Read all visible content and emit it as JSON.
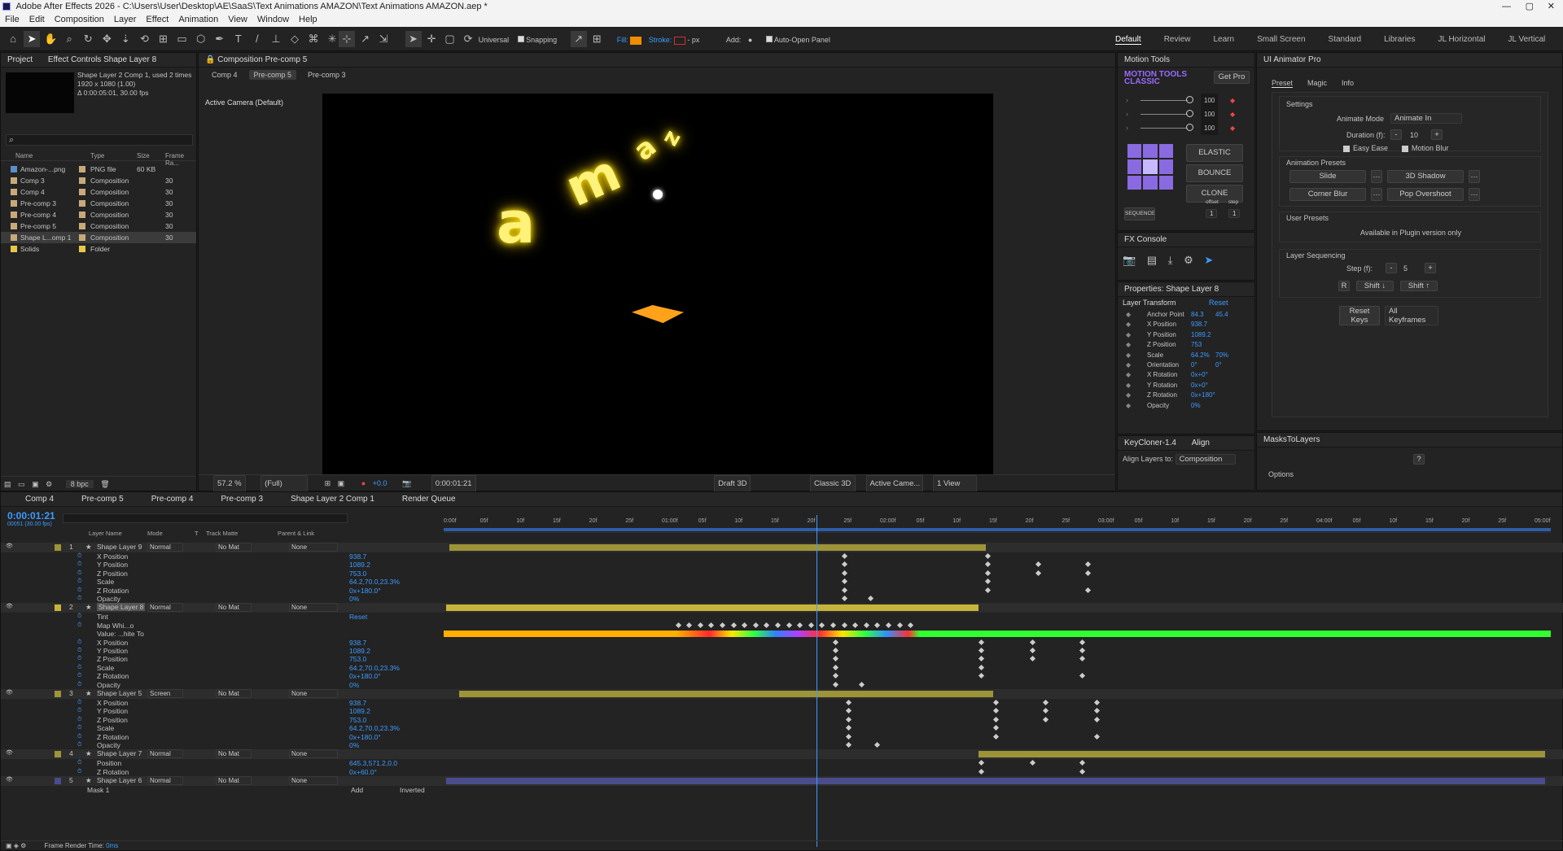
{
  "app": {
    "title": "Adobe After Effects 2026 - C:\\Users\\User\\Desktop\\AE\\SaaS\\Text Animations AMAZON\\Text Animations AMAZON.aep *",
    "menu": [
      "File",
      "Edit",
      "Composition",
      "Layer",
      "Effect",
      "Animation",
      "View",
      "Window",
      "Help"
    ]
  },
  "toolbar": {
    "universal": "Universal",
    "snapping": "Snapping",
    "fill_label": "Fill:",
    "stroke_label": "Stroke:",
    "stroke_unit": "- px",
    "add_label": "Add:",
    "auto_open": "Auto-Open Panel",
    "fill_color": "#f08c00",
    "workspaces": [
      "Default",
      "Review",
      "Learn",
      "Small Screen",
      "Standard",
      "Libraries",
      "JL Horizontal",
      "JL Vertical"
    ]
  },
  "project": {
    "tab": "Project",
    "tab2": "Effect Controls Shape Layer 8",
    "selected_name": "Shape Layer 2 Comp 1",
    "selected_usage": ", used 2 times",
    "selected_dims": "1920 x 1080 (1.00)",
    "selected_duration": "Δ 0:00:05:01, 30.00 fps",
    "columns": [
      "Name",
      "Type",
      "Size",
      "Frame Ra..."
    ],
    "items": [
      {
        "name": "Amazon-...png",
        "type": "PNG file",
        "size": "60 KB",
        "fps": "",
        "color": "#5c8ccc"
      },
      {
        "name": "Comp 3",
        "type": "Composition",
        "size": "",
        "fps": "30",
        "color": "#c8aa78"
      },
      {
        "name": "Comp 4",
        "type": "Composition",
        "size": "",
        "fps": "30",
        "color": "#c8aa78"
      },
      {
        "name": "Pre-comp 3",
        "type": "Composition",
        "size": "",
        "fps": "30",
        "color": "#c8aa78"
      },
      {
        "name": "Pre-comp 4",
        "type": "Composition",
        "size": "",
        "fps": "30",
        "color": "#c8aa78"
      },
      {
        "name": "Pre-comp 5",
        "type": "Composition",
        "size": "",
        "fps": "30",
        "color": "#c8aa78"
      },
      {
        "name": "Shape L...omp 1",
        "type": "Composition",
        "size": "",
        "fps": "30",
        "color": "#c8aa78"
      },
      {
        "name": "Solids",
        "type": "Folder",
        "size": "",
        "fps": "",
        "color": "#e8c84a"
      }
    ],
    "bpc": "8 bpc"
  },
  "composition": {
    "tab": "Composition Pre-comp 5",
    "breadcrumbs": [
      "Comp 4",
      "Pre-comp 5",
      "Pre-comp 3"
    ],
    "camera": "Active Camera (Default)",
    "zoom": "57.2 %",
    "resolution": "(Full)",
    "exposure": "+0.0",
    "time": "0:00:01:21",
    "renderer": "Draft 3D",
    "renderer2": "Classic 3D",
    "view_camera": "Active Came...",
    "views": "1 View",
    "letters": [
      "a",
      "m",
      "a",
      "z"
    ]
  },
  "motion_tools": {
    "title": "Motion Tools",
    "brand_line1": "MOTION TOOLS",
    "brand_line2": "CLASSIC",
    "get_pro": "Get Pro",
    "sliders": [
      "100",
      "100",
      "100"
    ],
    "buttons": [
      "ELASTIC",
      "BOUNCE",
      "CLONE"
    ],
    "sequence": "SEQUENCE",
    "offset_label": "offset",
    "step_label": "step",
    "offset": "1",
    "step": "1"
  },
  "fx_console": {
    "title": "FX Console"
  },
  "properties": {
    "title": "Properties: Shape Layer 8",
    "section": "Layer Transform",
    "reset": "Reset",
    "rows": [
      {
        "label": "Anchor Point",
        "v1": "84.3",
        "v2": "45.4"
      },
      {
        "label": "X Position",
        "v1": "938.7",
        "v2": ""
      },
      {
        "label": "Y Position",
        "v1": "1089.2",
        "v2": ""
      },
      {
        "label": "Z Position",
        "v1": "753",
        "v2": ""
      },
      {
        "label": "Scale",
        "v1": "64.2%",
        "v2": "70%"
      },
      {
        "label": "Orientation",
        "v1": "0°",
        "v2": "0°"
      },
      {
        "label": "X Rotation",
        "v1": "0x+0°",
        "v2": ""
      },
      {
        "label": "Y Rotation",
        "v1": "0x+0°",
        "v2": ""
      },
      {
        "label": "Z Rotation",
        "v1": "0x+180°",
        "v2": ""
      },
      {
        "label": "Opacity",
        "v1": "0%",
        "v2": ""
      }
    ]
  },
  "align": {
    "tab1": "KeyCloner-1.4",
    "tab2": "Align",
    "align_to_label": "Align Layers to:",
    "align_to": "Composition"
  },
  "ui_animator": {
    "title": "UI Animator Pro",
    "tabs": [
      "Preset",
      "Magic",
      "Info"
    ],
    "settings": "Settings",
    "animate_mode_label": "Animate Mode",
    "animate_mode": "Animate In",
    "duration_label": "Duration (f):",
    "duration": "10",
    "easy_ease": "Easy Ease",
    "motion_blur": "Motion Blur",
    "presets_title": "Animation Presets",
    "presets": [
      "Slide",
      "3D Shadow",
      "Corner Blur",
      "Pop Overshoot"
    ],
    "user_presets": "User Presets",
    "plugin_note": "Available in Plugin version only",
    "seq_title": "Layer Sequencing",
    "step_label": "Step (f):",
    "step": "5",
    "r": "R",
    "shift_down": "Shift ↓",
    "shift_up": "Shift ↑",
    "reset_keys": "Reset Keys",
    "all_keyframes": "All Keyframes"
  },
  "masks": {
    "title": "MasksToLayers",
    "options": "Options",
    "help": "?"
  },
  "timeline": {
    "tabs": [
      "Comp 4",
      "Pre-comp 5",
      "Pre-comp 4",
      "Pre-comp 3",
      "Shape Layer 2 Comp 1",
      "Render Queue"
    ],
    "time": "0:00:01:21",
    "time_sub": "00051 (30.00 fps)",
    "columns": [
      "Layer Name",
      "Mode",
      "T",
      "Track Matte",
      "Parent & Link"
    ],
    "ruler": [
      "0:00f",
      "05f",
      "10f",
      "15f",
      "20f",
      "25f",
      "01:00f",
      "05f",
      "10f",
      "15f",
      "20f",
      "25f",
      "02:00f",
      "05f",
      "10f",
      "15f",
      "20f",
      "25f",
      "03:00f",
      "05f",
      "10f",
      "15f",
      "20f",
      "25f",
      "04:00f",
      "05f",
      "10f",
      "15f",
      "20f",
      "25f",
      "05:00f"
    ],
    "rows": [
      {
        "kind": "layer",
        "num": "1",
        "name": "Shape Layer 9",
        "mode": "Normal",
        "matte": "No Mat",
        "parent": "None",
        "bar": [
          0.005,
          0.49
        ],
        "color": "#9d9438"
      },
      {
        "kind": "prop",
        "name": "X Position",
        "value": "938.7",
        "keys": [
          0.36,
          0.49
        ]
      },
      {
        "kind": "prop",
        "name": "Y Position",
        "value": "1089.2",
        "keys": [
          0.36,
          0.49,
          0.535,
          0.58
        ]
      },
      {
        "kind": "prop",
        "name": "Z Position",
        "value": "753.0",
        "keys": [
          0.36,
          0.49,
          0.535,
          0.58
        ]
      },
      {
        "kind": "prop",
        "name": "Scale",
        "value": "64.2,70.0,23.3%",
        "keys": [
          0.36,
          0.49
        ]
      },
      {
        "kind": "prop",
        "name": "Z Rotation",
        "value": "0x+180.0°",
        "keys": [
          0.36,
          0.49,
          0.58
        ]
      },
      {
        "kind": "prop",
        "name": "Opacity",
        "value": "0%",
        "keys": [
          0.36,
          0.384
        ]
      },
      {
        "kind": "layer",
        "num": "2",
        "name": "Shape Layer 8",
        "mode": "Normal",
        "matte": "No Mat",
        "parent": "None",
        "bar": [
          0.002,
          0.483
        ],
        "color": "#c8b43a"
      },
      {
        "kind": "effect",
        "name": "Tint",
        "value": "Reset",
        "keys": []
      },
      {
        "kind": "prop",
        "name": "Map Whi...o",
        "value": "",
        "keys": [
          0.21,
          0.22,
          0.23,
          0.24,
          0.25,
          0.26,
          0.27,
          0.28,
          0.29,
          0.3,
          0.31,
          0.32,
          0.33,
          0.34,
          0.35,
          0.36,
          0.37,
          0.38,
          0.39,
          0.4,
          0.41,
          0.42
        ]
      },
      {
        "kind": "gradient",
        "name": "Value: ...hite To",
        "value": "",
        "keys": []
      },
      {
        "kind": "prop",
        "name": "X Position",
        "value": "938.7",
        "keys": [
          0.352,
          0.484,
          0.53,
          0.575
        ]
      },
      {
        "kind": "prop",
        "name": "Y Position",
        "value": "1089.2",
        "keys": [
          0.352,
          0.484,
          0.53,
          0.575
        ]
      },
      {
        "kind": "prop",
        "name": "Z Position",
        "value": "753.0",
        "keys": [
          0.352,
          0.484,
          0.53,
          0.575
        ]
      },
      {
        "kind": "prop",
        "name": "Scale",
        "value": "64.2,70.0,23.3%",
        "keys": [
          0.352,
          0.484
        ]
      },
      {
        "kind": "prop",
        "name": "Z Rotation",
        "value": "0x+180.0°",
        "keys": [
          0.352,
          0.484,
          0.575
        ]
      },
      {
        "kind": "prop",
        "name": "Opacity",
        "value": "0%",
        "keys": [
          0.352,
          0.376
        ]
      },
      {
        "kind": "layer",
        "num": "3",
        "name": "Shape Layer 5",
        "mode": "Screen",
        "matte": "No Mat",
        "parent": "None",
        "bar": [
          0.014,
          0.496
        ],
        "color": "#9d9438"
      },
      {
        "kind": "prop",
        "name": "X Position",
        "value": "938.7",
        "keys": [
          0.364,
          0.497,
          0.542,
          0.588
        ]
      },
      {
        "kind": "prop",
        "name": "Y Position",
        "value": "1089.2",
        "keys": [
          0.364,
          0.497,
          0.542,
          0.588
        ]
      },
      {
        "kind": "prop",
        "name": "Z Position",
        "value": "753.0",
        "keys": [
          0.364,
          0.497,
          0.542,
          0.588
        ]
      },
      {
        "kind": "prop",
        "name": "Scale",
        "value": "64.2,70.0,23.3%",
        "keys": [
          0.364,
          0.497
        ]
      },
      {
        "kind": "prop",
        "name": "Z Rotation",
        "value": "0x+180.0°",
        "keys": [
          0.364,
          0.497,
          0.588
        ]
      },
      {
        "kind": "prop",
        "name": "Opacity",
        "value": "0%",
        "keys": [
          0.364,
          0.39
        ]
      },
      {
        "kind": "layer",
        "num": "4",
        "name": "Shape Layer 7",
        "mode": "Normal",
        "matte": "No Mat",
        "parent": "None",
        "bar": [
          0.483,
          0.995
        ],
        "color": "#9d9438"
      },
      {
        "kind": "prop",
        "name": "Position",
        "value": "645.3,571.2,0.0",
        "keys": [
          0.484,
          0.53,
          0.575
        ]
      },
      {
        "kind": "prop",
        "name": "Z Rotation",
        "value": "0x+60.0°",
        "keys": [
          0.484,
          0.575
        ]
      },
      {
        "kind": "layer",
        "num": "5",
        "name": "Shape Layer 6",
        "mode": "Normal",
        "matte": "No Mat",
        "parent": "None",
        "bar": [
          0.002,
          0.995
        ],
        "color": "#4a4d8c"
      }
    ],
    "mask_row": {
      "name": "Mask 1",
      "mode": "Add",
      "inverted": "Inverted"
    },
    "footer": "Frame Render Time:",
    "footer_value": "0ms",
    "playhead": 0.337
  }
}
